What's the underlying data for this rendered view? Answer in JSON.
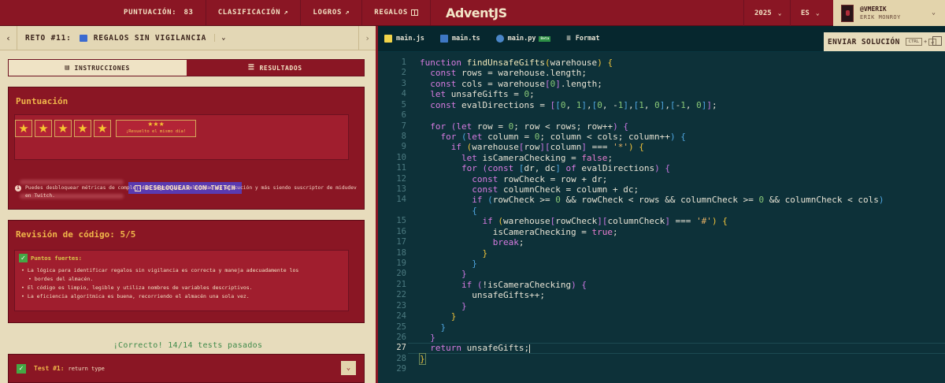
{
  "nav": {
    "score_label": "PUNTUACIÓN:",
    "score_value": "83",
    "ranking": "CLASIFICACIÓN",
    "achievements": "LOGROS",
    "gifts": "REGALOS",
    "logo_main": "Advent",
    "logo_js": "JS",
    "year": "2025",
    "language": "ES",
    "username": "@VMERIK",
    "realname": "ERIK MONROY"
  },
  "challenge": {
    "title": "RETO #11:",
    "name": "REGALOS SIN VIGILANCIA"
  },
  "tabs": {
    "instructions": "INSTRUCCIONES",
    "results": "RESULTADOS"
  },
  "score_card": {
    "title": "Puntuación",
    "stars": 5,
    "bonus_stars": "★★★",
    "bonus_text": "¡Resuelto el mismo día!",
    "twitch_button": "DESBLOQUEAR CON TWITCH",
    "note": "Puedes desbloquear métricas de complejidad cognitiva, velocidad de ejecución y más siendo suscriptor de midudev en Twitch."
  },
  "review": {
    "title": "Revisión de código: 5/5",
    "strengths_title": "Puntos fuertes:",
    "items": [
      "La lógica para identificar regalos sin vigilancia es correcta y maneja adecuadamente los",
      "bordes del almacén.",
      "El código es limpio, legible y utiliza nombres de variables descriptivos.",
      "La eficiencia algorítmica es buena, recorriendo el almacén una sola vez."
    ]
  },
  "tests": {
    "summary": "¡Correcto! 14/14 tests pasados",
    "first_name": "Test #1:",
    "first_desc": "return type"
  },
  "editor": {
    "files": [
      "main.js",
      "main.ts",
      "main.py"
    ],
    "beta_badge": "Beta",
    "format": "Format",
    "submit": "ENVIAR SOLUCIÓN",
    "shortcut_ctrl": "CTRL",
    "shortcut_plus": "+",
    "shortcut_enter": "↵",
    "current_line": 27
  },
  "colors": {
    "brand_red": "#8a1624",
    "cream": "#e7dcbc",
    "editor_bg": "#0d3139",
    "accent_gold": "#f0b74a",
    "success_green": "#45a845",
    "twitch_purple": "#5a3ab0"
  },
  "icons": {
    "ranking": "external-link-icon",
    "achievements": "external-link-icon",
    "gifts": "gift-icon",
    "back": "chevron-left-icon",
    "next": "chevron-right-icon",
    "check": "check-icon",
    "info": "info-icon"
  }
}
